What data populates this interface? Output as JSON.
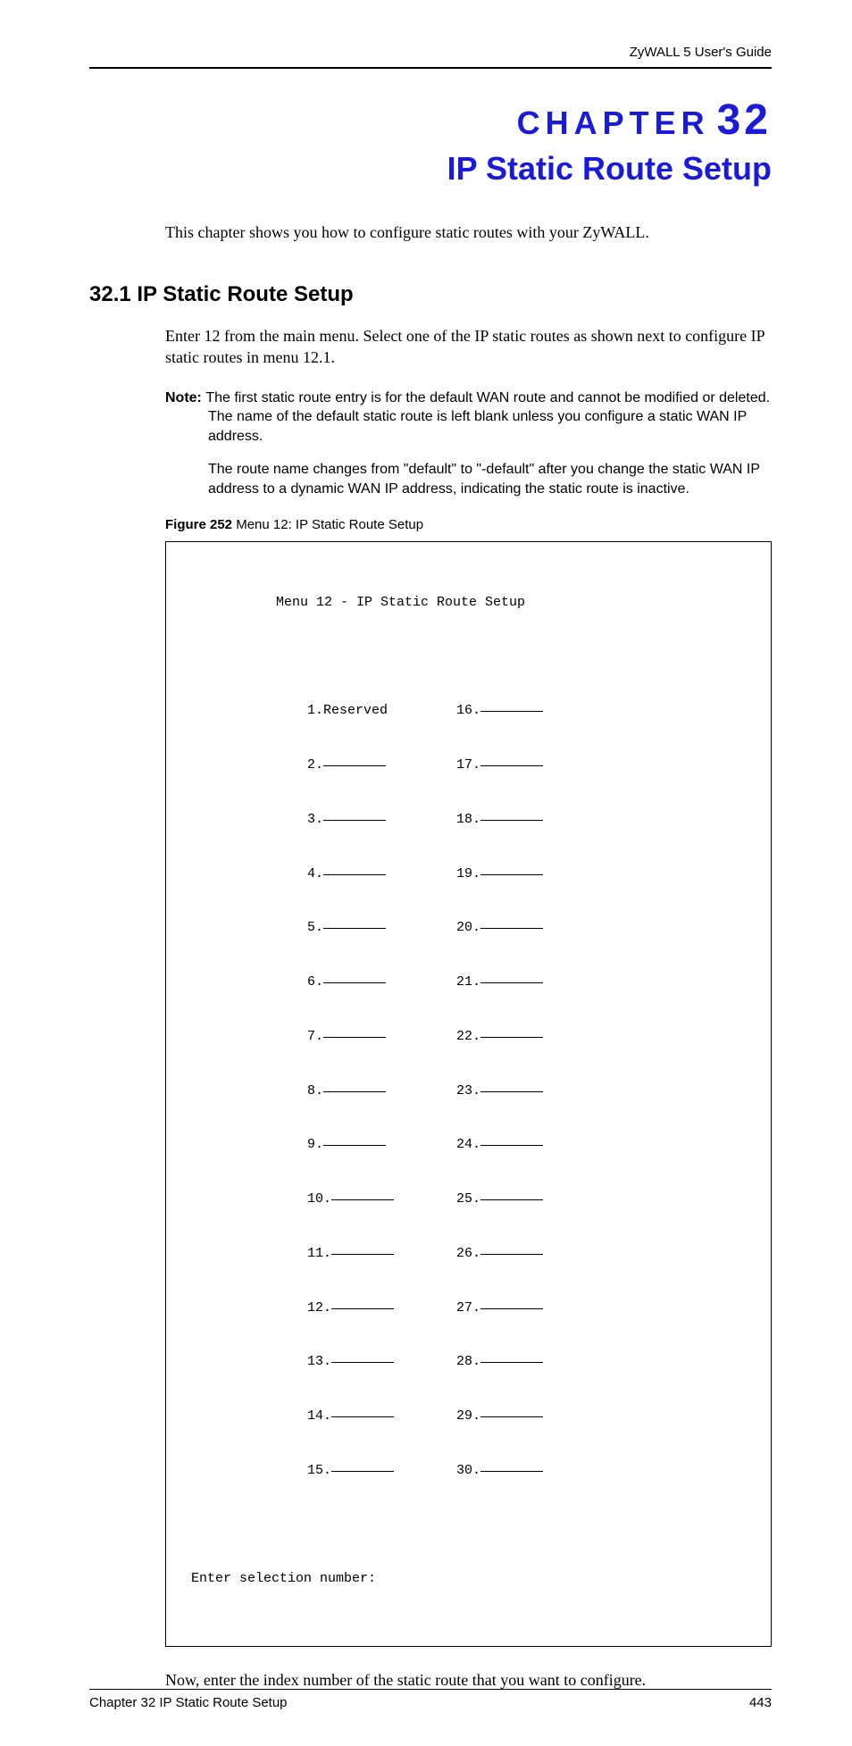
{
  "header": {
    "guide": "ZyWALL 5 User's Guide"
  },
  "chapter": {
    "label_word": "CHAPTER",
    "label_num": "32",
    "title": "IP Static Route Setup"
  },
  "intro": "This chapter shows you how to configure static routes with your ZyWALL.",
  "section": {
    "heading": "32.1  IP Static Route Setup",
    "para1": "Enter 12 from the main menu. Select one of the IP static routes as shown next to configure IP static routes in menu 12.1.",
    "note_label": "Note: ",
    "note_body1": "The first static route entry is for the default WAN route and cannot be modified or deleted. The name of the default static route is left blank unless you configure a static WAN IP address.",
    "note_body2": "The route name changes from \"default\" to \"-default\" after you change the static WAN IP address to a dynamic WAN IP address, indicating the static route is inactive."
  },
  "figure": {
    "label": "Figure 252",
    "caption": "   Menu 12: IP Static Route Setup"
  },
  "terminal": {
    "title": "Menu 12 - IP Static Route Setup",
    "col1": [
      " 1.Reserved",
      " 2.",
      " 3.",
      " 4.",
      " 5.",
      " 6.",
      " 7.",
      " 8.",
      " 9.",
      "10.",
      "11.",
      "12.",
      "13.",
      "14.",
      "15."
    ],
    "col2": [
      "16.",
      "17.",
      "18.",
      "19.",
      "20.",
      "21.",
      "22.",
      "23.",
      "24.",
      "25.",
      "26.",
      "27.",
      "28.",
      "29.",
      "30."
    ],
    "prompt": "Enter selection number:"
  },
  "after_figure": "Now, enter the index number of the static route that you want to configure.",
  "footer": {
    "left": "Chapter 32 IP Static Route Setup",
    "right": "443"
  }
}
